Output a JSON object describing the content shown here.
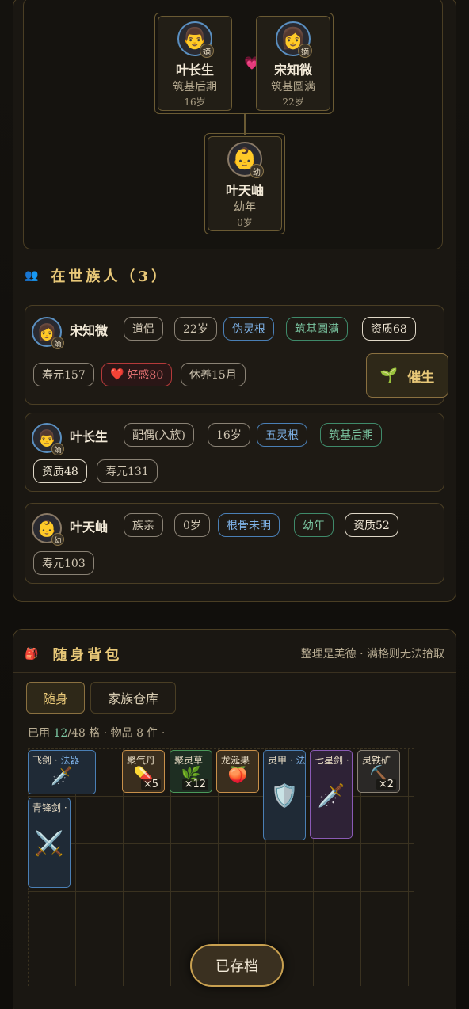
{
  "family_tree": {
    "parents": [
      {
        "name": "叶长生",
        "realm": "筑基后期",
        "age": "16岁",
        "avatar": "👨",
        "badge": "嫡"
      },
      {
        "name": "宋知微",
        "realm": "筑基圆满",
        "age": "22岁",
        "avatar": "👩",
        "badge": "嫡"
      }
    ],
    "heart_icon": "💗",
    "child": {
      "name": "叶天岫",
      "realm": "幼年",
      "age": "0岁",
      "avatar": "👶",
      "badge": "幼"
    }
  },
  "living_section": {
    "icon": "👥",
    "title": "在世族人（3）"
  },
  "members": [
    {
      "name": "宋知微",
      "avatar": "👩",
      "badge": "嫡",
      "tags": [
        "道侣",
        "22岁",
        "伪灵根",
        "筑基圆满",
        "资质68"
      ],
      "tags2": [
        "寿元157",
        "好感80",
        "休养15月"
      ],
      "heart": "❤️",
      "urge_label": "催生",
      "urge_icon": "🌱"
    },
    {
      "name": "叶长生",
      "avatar": "👨",
      "badge": "嫡",
      "tags": [
        "配偶(入族)",
        "16岁",
        "五灵根",
        "筑基后期"
      ],
      "tags2": [
        "资质48",
        "寿元131"
      ]
    },
    {
      "name": "叶天岫",
      "avatar": "👶",
      "badge": "幼",
      "tags": [
        "族亲",
        "0岁",
        "根骨未明",
        "幼年",
        "资质52"
      ],
      "tags2": [
        "寿元103"
      ]
    }
  ],
  "bag": {
    "icon": "🎒",
    "title": "随身背包",
    "hint": "整理是美德 · 满格则无法拾取",
    "tabs": [
      "随身",
      "家族仓库"
    ],
    "usage_prefix": "已用",
    "usage_num": "12",
    "usage_suffix": "/48 格 · 物品 8 件 ·",
    "items": [
      {
        "name": "飞剑 · ",
        "cat": "法器",
        "icon": "🗡️",
        "qty": ""
      },
      {
        "name": "聚气丹",
        "cat": "",
        "icon": "💊",
        "qty": "×5"
      },
      {
        "name": "聚灵草",
        "cat": "",
        "icon": "🌿",
        "qty": "×12"
      },
      {
        "name": "龙涎果",
        "cat": "",
        "icon": "🍑",
        "qty": ""
      },
      {
        "name": "灵甲 · ",
        "cat": "法",
        "icon": "🛡️",
        "qty": ""
      },
      {
        "name": "七星剑 · ",
        "cat": "",
        "icon": "🗡️",
        "qty": ""
      },
      {
        "name": "灵铁矿",
        "cat": "",
        "icon": "⛏️",
        "qty": "×2"
      },
      {
        "name": "青锋剑 · ",
        "cat": "",
        "icon": "⚔️",
        "qty": ""
      }
    ]
  },
  "save_label": "已存档"
}
